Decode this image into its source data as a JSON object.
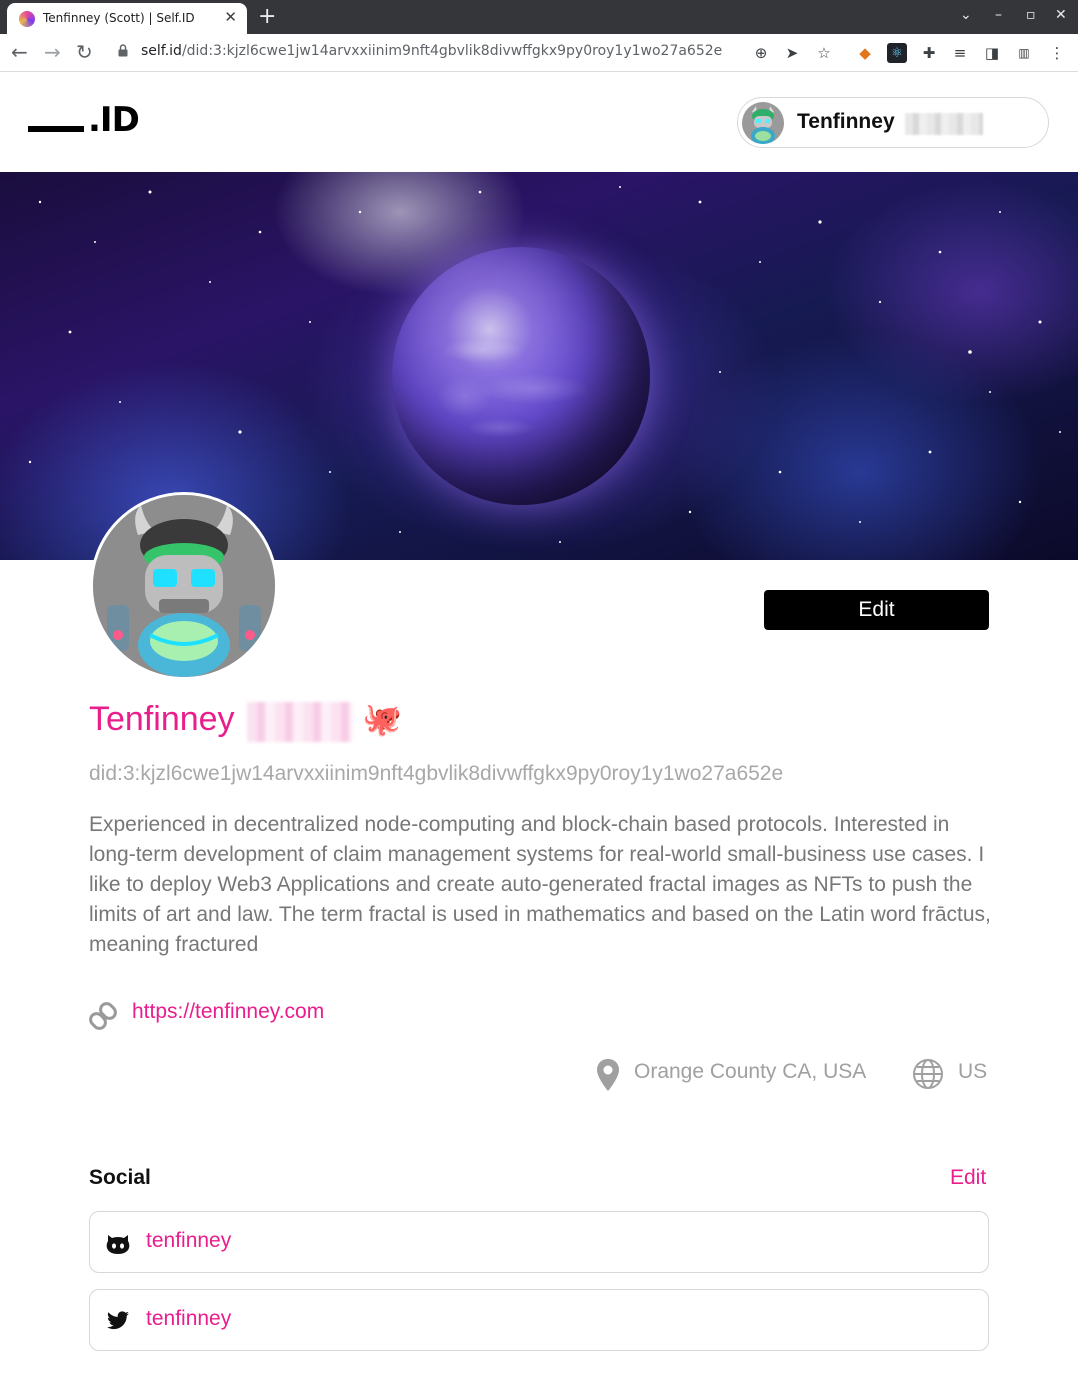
{
  "browser": {
    "tab_title": "Tenfinney (Scott) | Self.ID",
    "tab_close": "✕",
    "new_tab": "+",
    "url_host": "self.id",
    "url_path": "/did:3:kjzl6cwe1jw14arvxxiinim9nft4gbvlik8divwffgkx9py0roy1y1wo27a652e"
  },
  "header": {
    "logo_text": ".ID",
    "user_name": "Tenfinney"
  },
  "profile": {
    "name": "Tenfinney",
    "emoji": "🐙",
    "did": "did:3:kjzl6cwe1jw14arvxxiinim9nft4gbvlik8divwffgkx9py0roy1y1wo27a652e",
    "bio": "Experienced in decentralized node-computing and block-chain based protocols. Interested in long-term development of claim management systems for real-world small-business use cases. I like to deploy Web3 Applications and create auto-generated fractal images as NFTs to push the limits of art and law. The term fractal is used in mathematics and based on the Latin word frāctus, meaning fractured",
    "website": "https://tenfinney.com",
    "location": "Orange County CA, USA",
    "country": "US",
    "edit_label": "Edit"
  },
  "social": {
    "title": "Social",
    "edit_label": "Edit",
    "accounts": [
      {
        "platform": "github",
        "icon": "github-icon",
        "handle": "tenfinney"
      },
      {
        "platform": "twitter",
        "icon": "twitter-icon",
        "handle": "tenfinney"
      }
    ]
  },
  "colors": {
    "accent": "#e91e8c",
    "muted": "#a0a0a0",
    "bio": "#777777"
  }
}
